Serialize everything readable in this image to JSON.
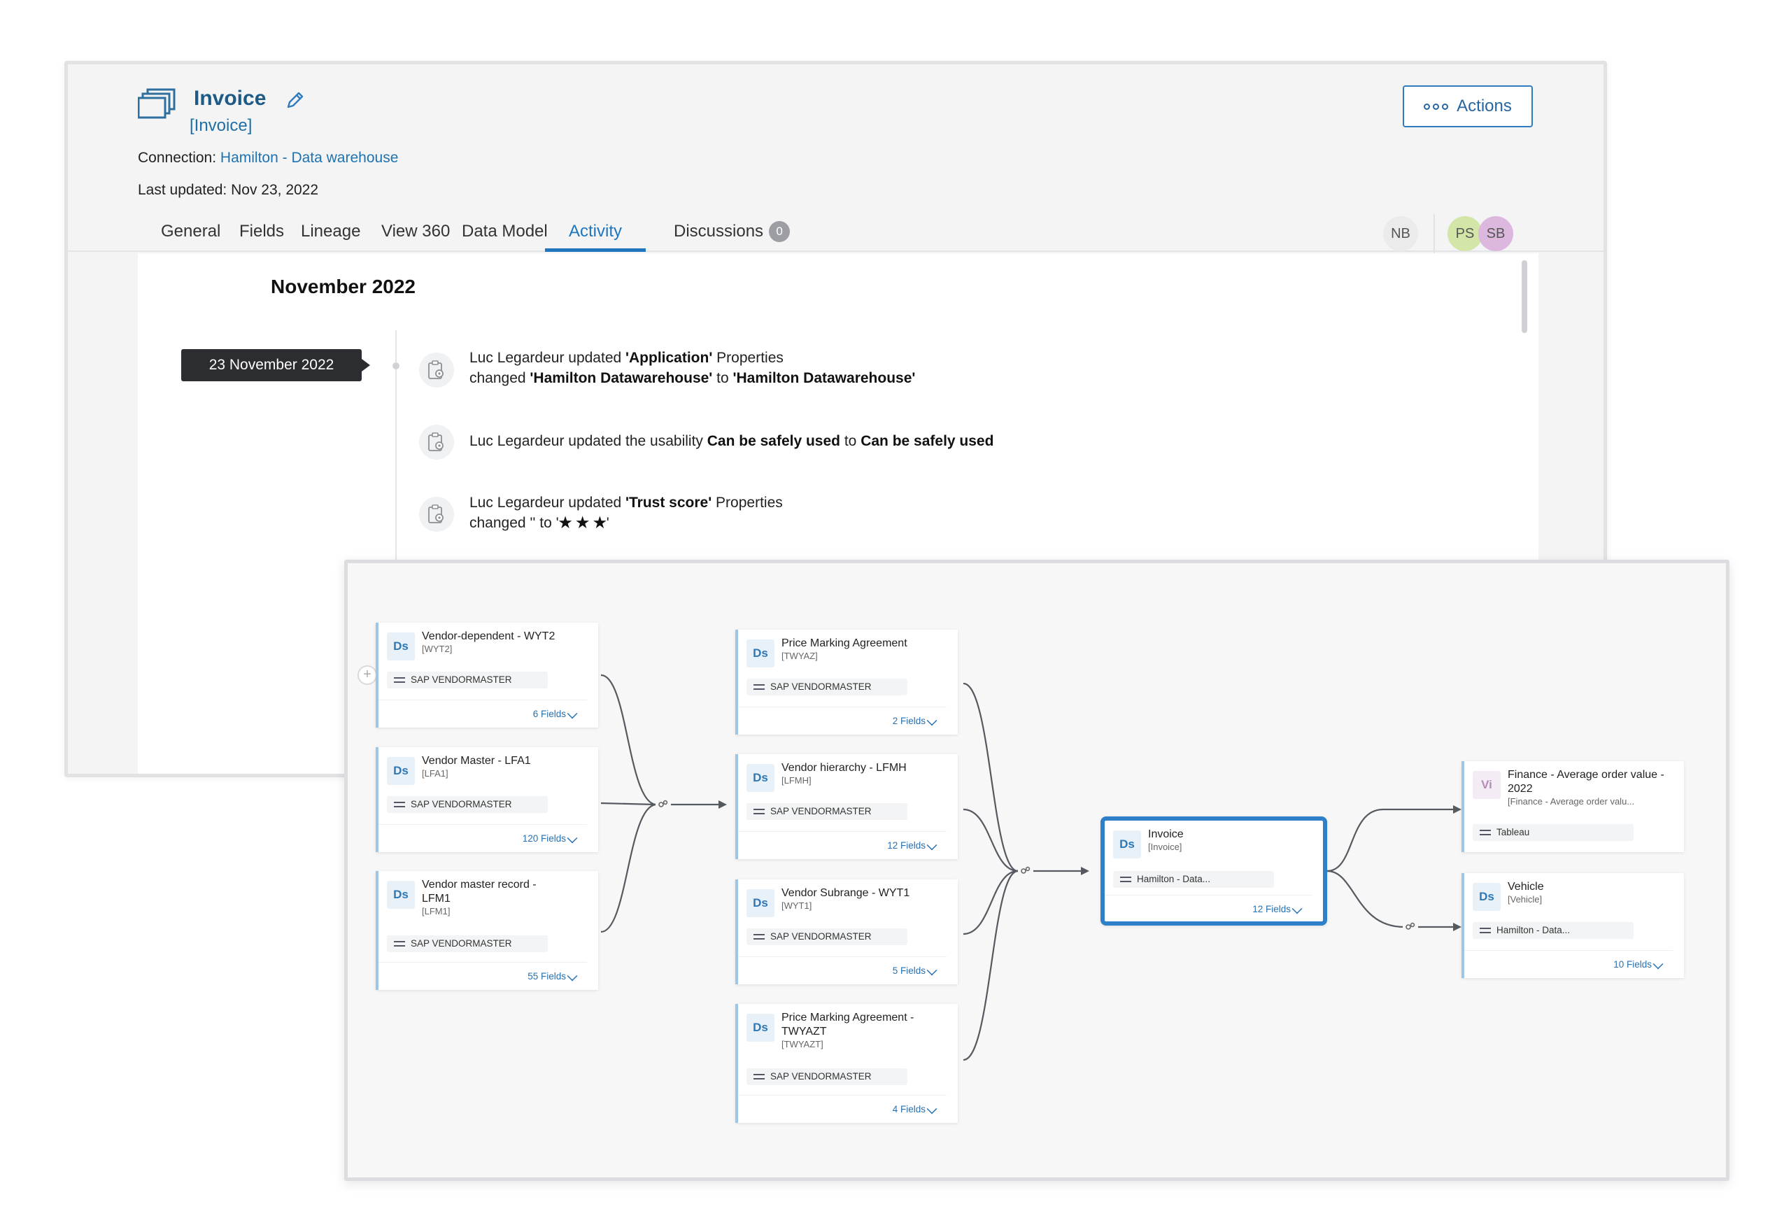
{
  "asset": {
    "title": "Invoice",
    "technical_name": "[Invoice]",
    "connection_label": "Connection:",
    "connection_value": "Hamilton - Data warehouse",
    "last_updated": "Last updated: Nov 23, 2022",
    "actions_label": "Actions"
  },
  "tabs": [
    {
      "label": "General"
    },
    {
      "label": "Fields"
    },
    {
      "label": "Lineage"
    },
    {
      "label": "View 360"
    },
    {
      "label": "Data Model"
    },
    {
      "label": "Activity",
      "active": true
    },
    {
      "label": "Discussions",
      "badge": "0"
    }
  ],
  "avatars": [
    "NB",
    "PS",
    "SB"
  ],
  "activity": {
    "month": "November 2022",
    "date": "23 November 2022",
    "events": [
      {
        "l1": [
          "Luc Legardeur updated ",
          "'Application'",
          " Properties"
        ],
        "l2": [
          "changed ",
          "'Hamilton Datawarehouse'",
          " to ",
          "'Hamilton Datawarehouse'"
        ]
      },
      {
        "l1": [
          "Luc Legardeur updated the usability ",
          "Can be safely used",
          " to ",
          "Can be safely used"
        ]
      },
      {
        "l1": [
          "Luc Legardeur updated ",
          "'Trust score'",
          " Properties"
        ],
        "l2": [
          "changed '' to '",
          "★ ★ ★",
          "'"
        ]
      }
    ]
  },
  "lineage": {
    "nodes": [
      {
        "id": "wyt2",
        "type": "Ds",
        "name": "Vendor-dependent - WYT2",
        "tech": "[WYT2]",
        "source": "SAP VENDORMASTER",
        "fields": "6 Fields"
      },
      {
        "id": "lfa1",
        "type": "Ds",
        "name": "Vendor Master - LFA1",
        "tech": "[LFA1]",
        "source": "SAP VENDORMASTER",
        "fields": "120 Fields"
      },
      {
        "id": "lfm1",
        "type": "Ds",
        "name": "Vendor master record - LFM1",
        "tech": "[LFM1]",
        "source": "SAP VENDORMASTER",
        "fields": "55 Fields"
      },
      {
        "id": "twyaz",
        "type": "Ds",
        "name": "Price Marking Agreement",
        "tech": "[TWYAZ]",
        "source": "SAP VENDORMASTER",
        "fields": "2 Fields"
      },
      {
        "id": "lfmh",
        "type": "Ds",
        "name": "Vendor hierarchy - LFMH",
        "tech": "[LFMH]",
        "source": "SAP VENDORMASTER",
        "fields": "12 Fields"
      },
      {
        "id": "wyt1",
        "type": "Ds",
        "name": "Vendor Subrange - WYT1",
        "tech": "[WYT1]",
        "source": "SAP VENDORMASTER",
        "fields": "5 Fields"
      },
      {
        "id": "twyazt",
        "type": "Ds",
        "name": "Price Marking Agreement - TWYAZT",
        "tech": "[TWYAZT]",
        "source": "SAP VENDORMASTER",
        "fields": "4 Fields"
      },
      {
        "id": "invoice",
        "type": "Ds",
        "name": "Invoice",
        "tech": "[Invoice]",
        "source": "Hamilton - Data...",
        "fields": "12 Fields"
      },
      {
        "id": "finance",
        "type": "Vi",
        "name": "Finance - Average order value - 2022",
        "tech": "[Finance - Average order valu...",
        "source": "Tableau",
        "fields": ""
      },
      {
        "id": "vehicle",
        "type": "Ds",
        "name": "Vehicle",
        "tech": "[Vehicle]",
        "source": "Hamilton - Data...",
        "fields": "10 Fields"
      }
    ]
  }
}
